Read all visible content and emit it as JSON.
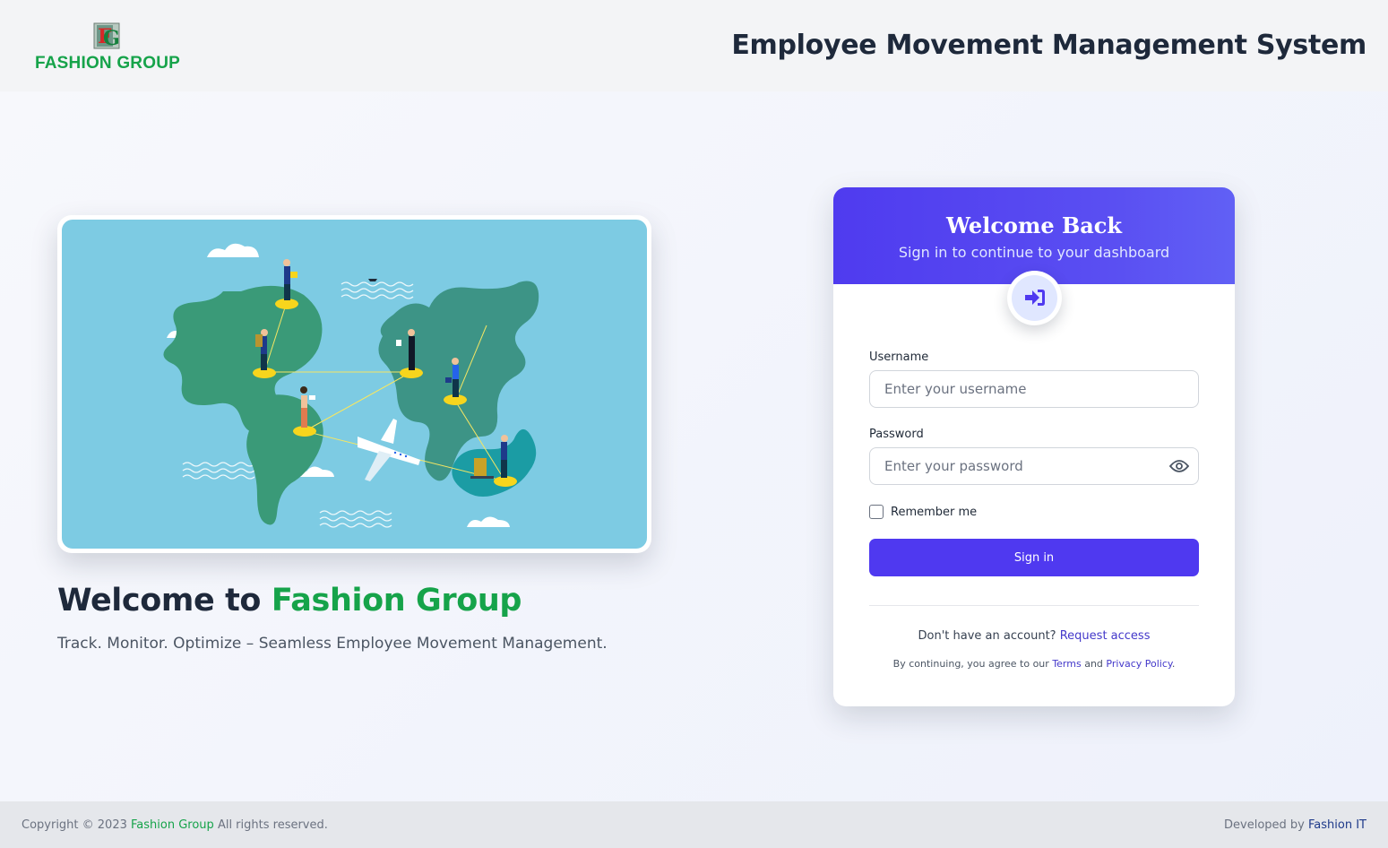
{
  "header": {
    "logo_text": "FASHION GROUP",
    "title": "Employee Movement Management System"
  },
  "hero": {
    "welcome_prefix": "Welcome to ",
    "welcome_brand": "Fashion Group",
    "tagline": "Track. Monitor. Optimize – Seamless Employee Movement Management."
  },
  "login": {
    "title": "Welcome Back",
    "subtitle": "Sign in to continue to your dashboard",
    "username_label": "Username",
    "username_placeholder": "Enter your username",
    "username_value": "",
    "password_label": "Password",
    "password_placeholder": "Enter your password",
    "password_value": "",
    "remember_label": "Remember me",
    "remember_checked": false,
    "signin_label": "Sign in",
    "no_account_text": "Don't have an account?",
    "request_access_label": "Request access",
    "terms_prefix": "By continuing, you agree to our",
    "terms_label": "Terms",
    "and_text": "and",
    "privacy_label": "Privacy Policy",
    "terms_suffix": "."
  },
  "footer": {
    "copyright_prefix": "Copyright © 2023",
    "copyright_brand": "Fashion Group",
    "copyright_suffix": "All rights reserved.",
    "developed_prefix": "Developed by",
    "developed_brand": "Fashion IT"
  },
  "icons": {
    "logo": "fashion-group-logo-icon",
    "badge": "sign-in-icon",
    "password_toggle": "eye-icon"
  },
  "colors": {
    "brand_green": "#16a34a",
    "primary": "#4f39f0",
    "header_gradient_start": "#4f3bef",
    "header_gradient_end": "#6160f5",
    "link": "#4338ca",
    "illustration_bg": "#7dcbe3"
  }
}
